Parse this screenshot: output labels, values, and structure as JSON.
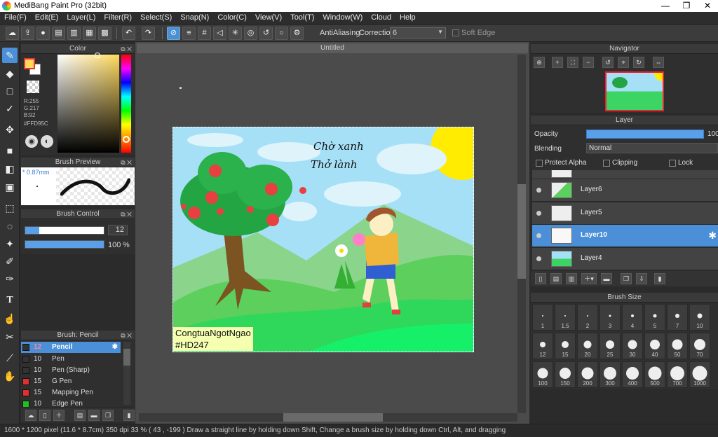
{
  "window": {
    "title": "MediBang Paint Pro (32bit)",
    "controls": [
      "—",
      "❐",
      "✕"
    ]
  },
  "menu": [
    "File(F)",
    "Edit(E)",
    "Layer(L)",
    "Filter(R)",
    "Select(S)",
    "Snap(N)",
    "Color(C)",
    "View(V)",
    "Tool(T)",
    "Window(W)",
    "Cloud",
    "Help"
  ],
  "toolbar": {
    "antialias_label": "AntiAliasing",
    "correction_label": "Correction",
    "correction_value": "6",
    "soft_edge_label": "Soft Edge"
  },
  "color_panel": {
    "title": "Color",
    "r": "R:255",
    "g": "G:217",
    "b": "B:92",
    "hex": "#FFD95C",
    "main_color": "#FFD95C"
  },
  "brush_preview": {
    "title": "Brush Preview",
    "size": "* 0.87mm"
  },
  "brush_control": {
    "title": "Brush Control",
    "size_value": "12",
    "opacity_value": "100",
    "opacity_unit": "%",
    "size_fraction": 0.18,
    "opacity_fraction": 1.0
  },
  "brush_list": {
    "title": "Brush: Pencil",
    "items": [
      {
        "size": "12",
        "name": "Pencil",
        "color": "#333333",
        "selected": true
      },
      {
        "size": "10",
        "name": "Pen",
        "color": "#333333"
      },
      {
        "size": "10",
        "name": "Pen (Sharp)",
        "color": "#333333"
      },
      {
        "size": "15",
        "name": "G Pen",
        "color": "#e03030"
      },
      {
        "size": "15",
        "name": "Mapping Pen",
        "color": "#e03030"
      },
      {
        "size": "10",
        "name": "Edge Pen",
        "color": "#20c020"
      }
    ]
  },
  "document": {
    "tab": "Untitled"
  },
  "artwork": {
    "title_line1": "Chờ xanh",
    "title_line2": "Thở lành",
    "watermark_line1": "CongtuaNgotNgao",
    "watermark_line2": "#HD247"
  },
  "navigator": {
    "title": "Navigator"
  },
  "layer_panel": {
    "title": "Layer",
    "opacity_label": "Opacity",
    "opacity_value": "100",
    "blending_label": "Blending",
    "blending_value": "Normal",
    "protect_alpha": "Protect Alpha",
    "clipping": "Clipping",
    "lock": "Lock",
    "layers": [
      {
        "name": "Layer6"
      },
      {
        "name": "Layer5"
      },
      {
        "name": "Layer10",
        "selected": true
      },
      {
        "name": "Layer4"
      }
    ]
  },
  "brush_size": {
    "title": "Brush Size",
    "sizes": [
      "1",
      "1.5",
      "2",
      "3",
      "4",
      "5",
      "7",
      "10",
      "12",
      "15",
      "20",
      "25",
      "30",
      "40",
      "50",
      "70",
      "100",
      "150",
      "200",
      "300",
      "400",
      "500",
      "700",
      "1000"
    ]
  },
  "status": {
    "text": "1600 * 1200 pixel   (11.6 * 8.7cm)   350 dpi   33 %   ( 43 , -199 )   Draw a straight line by holding down Shift, Change a brush size by holding down Ctrl, Alt, and dragging"
  }
}
